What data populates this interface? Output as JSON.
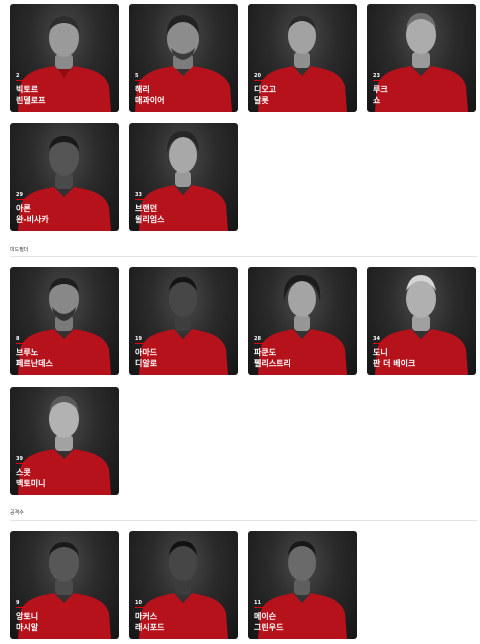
{
  "sections": [
    {
      "label": "",
      "players": [
        {
          "number": "2",
          "first": "빅토르",
          "last": "린델로프"
        },
        {
          "number": "5",
          "first": "해리",
          "last": "매과이어"
        },
        {
          "number": "20",
          "first": "디오고",
          "last": "달롯"
        },
        {
          "number": "23",
          "first": "루크",
          "last": "쇼"
        },
        {
          "number": "29",
          "first": "아론",
          "last": "완-비사카"
        },
        {
          "number": "33",
          "first": "브랜던",
          "last": "윌리엄스"
        }
      ]
    },
    {
      "label": "미드필더",
      "players": [
        {
          "number": "8",
          "first": "브루노",
          "last": "페르난데스"
        },
        {
          "number": "19",
          "first": "아마드",
          "last": "디알로"
        },
        {
          "number": "28",
          "first": "파쿤도",
          "last": "펠리스트리"
        },
        {
          "number": "34",
          "first": "도니",
          "last": "판 더 베이크"
        },
        {
          "number": "39",
          "first": "스콧",
          "last": "맥토미니"
        }
      ]
    },
    {
      "label": "공격수",
      "players": [
        {
          "number": "9",
          "first": "앙토니",
          "last": "마시알"
        },
        {
          "number": "10",
          "first": "마커스",
          "last": "래시포드"
        },
        {
          "number": "11",
          "first": "메이슨",
          "last": "그린우드"
        }
      ]
    }
  ],
  "colors": {
    "accent": "#e0000f",
    "kit": "#b5121b",
    "card_bg": "#222222"
  }
}
